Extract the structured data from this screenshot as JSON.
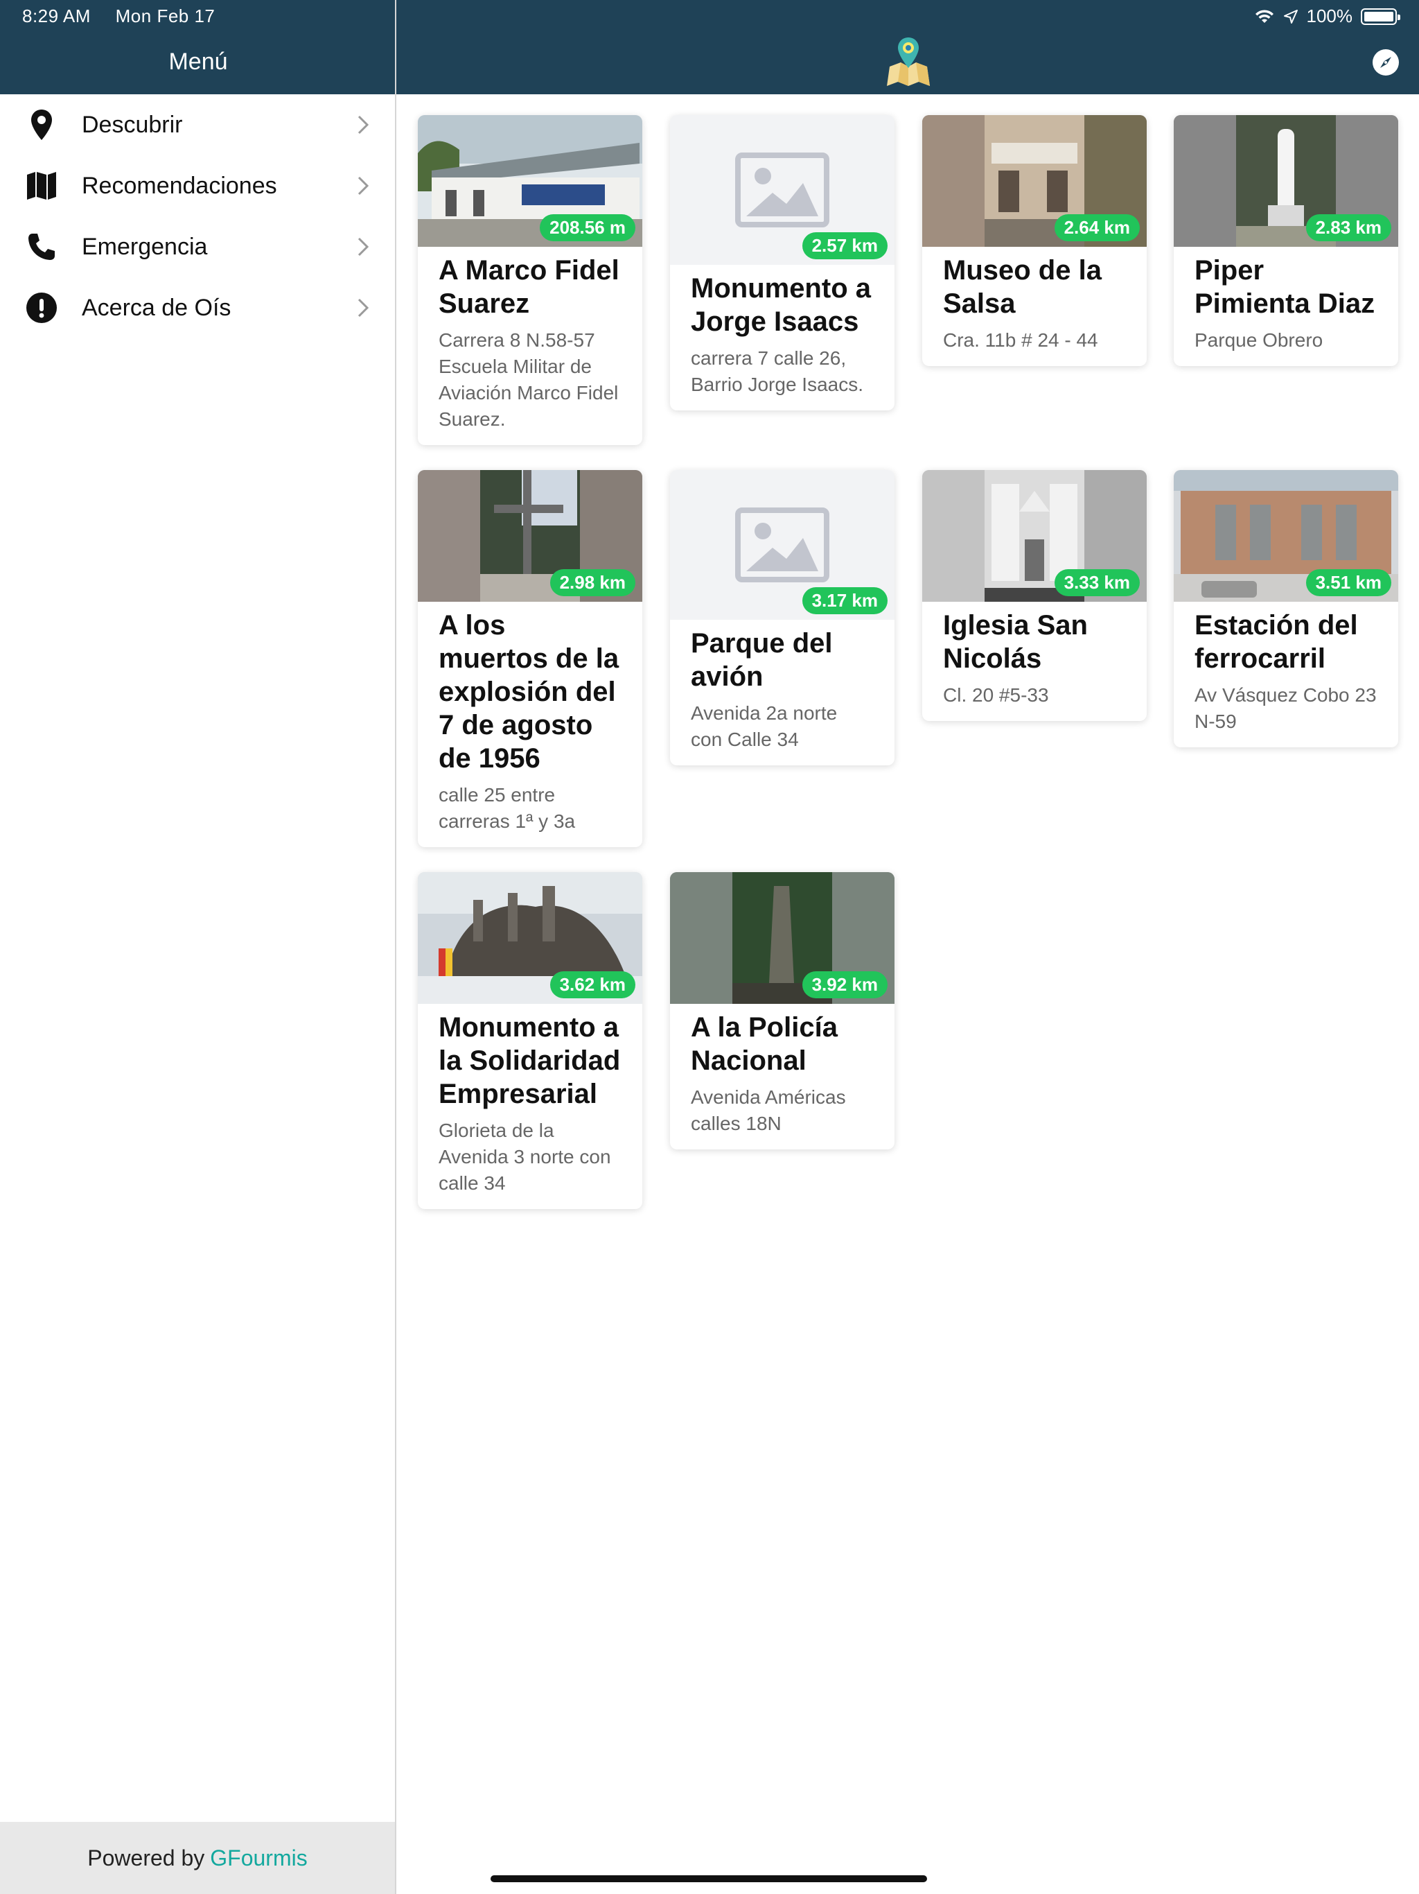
{
  "status": {
    "time": "8:29 AM",
    "date": "Mon Feb 17",
    "battery": "100%"
  },
  "sidebar": {
    "title": "Menú",
    "items": [
      {
        "label": "Descubrir",
        "icon": "map-pin-icon"
      },
      {
        "label": "Recomendaciones",
        "icon": "map-icon"
      },
      {
        "label": "Emergencia",
        "icon": "phone-icon"
      },
      {
        "label": "Acerca de Oís",
        "icon": "info-alert-icon"
      }
    ],
    "footer": {
      "prefix": "Powered by",
      "brand": "GFourmis"
    }
  },
  "places": [
    {
      "title": "A Marco Fidel Suarez",
      "address": "Carrera 8 N.58-57 Escuela Militar de Aviación Marco Fidel Suarez.",
      "distance": "208.56 m",
      "image": "photo"
    },
    {
      "title": "Monumento a Jorge Isaacs",
      "address": "carrera 7 calle 26, Barrio Jorge Isaacs.",
      "distance": "2.57 km",
      "image": "placeholder"
    },
    {
      "title": "Museo de la Salsa",
      "address": "Cra. 11b # 24 - 44",
      "distance": "2.64 km",
      "image": "photo"
    },
    {
      "title": "Piper Pimienta Diaz",
      "address": "Parque Obrero",
      "distance": "2.83 km",
      "image": "photo"
    },
    {
      "title": "A los muertos de la explosión del 7 de agosto de 1956",
      "address": "calle 25 entre carreras 1ª y 3a",
      "distance": "2.98 km",
      "image": "photo"
    },
    {
      "title": "Parque del avión",
      "address": "Avenida 2a norte con Calle 34",
      "distance": "3.17 km",
      "image": "placeholder"
    },
    {
      "title": "Iglesia San Nicolás",
      "address": "Cl. 20 #5-33",
      "distance": "3.33 km",
      "image": "photo"
    },
    {
      "title": "Estación del ferrocarril",
      "address": "Av Vásquez Cobo 23 N-59",
      "distance": "3.51 km",
      "image": "photo"
    },
    {
      "title": "Monumento a la Solidaridad Empresarial",
      "address": "Glorieta de la Avenida 3 norte con calle 34",
      "distance": "3.62 km",
      "image": "photo"
    },
    {
      "title": "A la Policía Nacional",
      "address": "Avenida Américas calles 18N",
      "distance": "3.92 km",
      "image": "photo"
    }
  ],
  "colors": {
    "header": "#1f4257",
    "badge": "#21c45a",
    "brand": "#13a89e"
  }
}
